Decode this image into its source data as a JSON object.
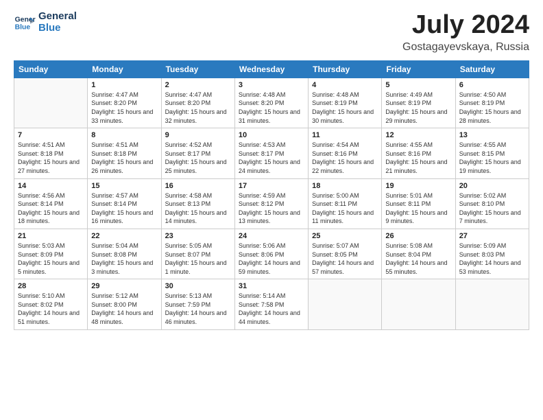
{
  "logo": {
    "line1": "General",
    "line2": "Blue"
  },
  "title": "July 2024",
  "location": "Gostagayevskaya, Russia",
  "days_of_week": [
    "Sunday",
    "Monday",
    "Tuesday",
    "Wednesday",
    "Thursday",
    "Friday",
    "Saturday"
  ],
  "weeks": [
    [
      {
        "day": "",
        "sunrise": "",
        "sunset": "",
        "daylight": ""
      },
      {
        "day": "1",
        "sunrise": "Sunrise: 4:47 AM",
        "sunset": "Sunset: 8:20 PM",
        "daylight": "Daylight: 15 hours and 33 minutes."
      },
      {
        "day": "2",
        "sunrise": "Sunrise: 4:47 AM",
        "sunset": "Sunset: 8:20 PM",
        "daylight": "Daylight: 15 hours and 32 minutes."
      },
      {
        "day": "3",
        "sunrise": "Sunrise: 4:48 AM",
        "sunset": "Sunset: 8:20 PM",
        "daylight": "Daylight: 15 hours and 31 minutes."
      },
      {
        "day": "4",
        "sunrise": "Sunrise: 4:48 AM",
        "sunset": "Sunset: 8:19 PM",
        "daylight": "Daylight: 15 hours and 30 minutes."
      },
      {
        "day": "5",
        "sunrise": "Sunrise: 4:49 AM",
        "sunset": "Sunset: 8:19 PM",
        "daylight": "Daylight: 15 hours and 29 minutes."
      },
      {
        "day": "6",
        "sunrise": "Sunrise: 4:50 AM",
        "sunset": "Sunset: 8:19 PM",
        "daylight": "Daylight: 15 hours and 28 minutes."
      }
    ],
    [
      {
        "day": "7",
        "sunrise": "Sunrise: 4:51 AM",
        "sunset": "Sunset: 8:18 PM",
        "daylight": "Daylight: 15 hours and 27 minutes."
      },
      {
        "day": "8",
        "sunrise": "Sunrise: 4:51 AM",
        "sunset": "Sunset: 8:18 PM",
        "daylight": "Daylight: 15 hours and 26 minutes."
      },
      {
        "day": "9",
        "sunrise": "Sunrise: 4:52 AM",
        "sunset": "Sunset: 8:17 PM",
        "daylight": "Daylight: 15 hours and 25 minutes."
      },
      {
        "day": "10",
        "sunrise": "Sunrise: 4:53 AM",
        "sunset": "Sunset: 8:17 PM",
        "daylight": "Daylight: 15 hours and 24 minutes."
      },
      {
        "day": "11",
        "sunrise": "Sunrise: 4:54 AM",
        "sunset": "Sunset: 8:16 PM",
        "daylight": "Daylight: 15 hours and 22 minutes."
      },
      {
        "day": "12",
        "sunrise": "Sunrise: 4:55 AM",
        "sunset": "Sunset: 8:16 PM",
        "daylight": "Daylight: 15 hours and 21 minutes."
      },
      {
        "day": "13",
        "sunrise": "Sunrise: 4:55 AM",
        "sunset": "Sunset: 8:15 PM",
        "daylight": "Daylight: 15 hours and 19 minutes."
      }
    ],
    [
      {
        "day": "14",
        "sunrise": "Sunrise: 4:56 AM",
        "sunset": "Sunset: 8:14 PM",
        "daylight": "Daylight: 15 hours and 18 minutes."
      },
      {
        "day": "15",
        "sunrise": "Sunrise: 4:57 AM",
        "sunset": "Sunset: 8:14 PM",
        "daylight": "Daylight: 15 hours and 16 minutes."
      },
      {
        "day": "16",
        "sunrise": "Sunrise: 4:58 AM",
        "sunset": "Sunset: 8:13 PM",
        "daylight": "Daylight: 15 hours and 14 minutes."
      },
      {
        "day": "17",
        "sunrise": "Sunrise: 4:59 AM",
        "sunset": "Sunset: 8:12 PM",
        "daylight": "Daylight: 15 hours and 13 minutes."
      },
      {
        "day": "18",
        "sunrise": "Sunrise: 5:00 AM",
        "sunset": "Sunset: 8:11 PM",
        "daylight": "Daylight: 15 hours and 11 minutes."
      },
      {
        "day": "19",
        "sunrise": "Sunrise: 5:01 AM",
        "sunset": "Sunset: 8:11 PM",
        "daylight": "Daylight: 15 hours and 9 minutes."
      },
      {
        "day": "20",
        "sunrise": "Sunrise: 5:02 AM",
        "sunset": "Sunset: 8:10 PM",
        "daylight": "Daylight: 15 hours and 7 minutes."
      }
    ],
    [
      {
        "day": "21",
        "sunrise": "Sunrise: 5:03 AM",
        "sunset": "Sunset: 8:09 PM",
        "daylight": "Daylight: 15 hours and 5 minutes."
      },
      {
        "day": "22",
        "sunrise": "Sunrise: 5:04 AM",
        "sunset": "Sunset: 8:08 PM",
        "daylight": "Daylight: 15 hours and 3 minutes."
      },
      {
        "day": "23",
        "sunrise": "Sunrise: 5:05 AM",
        "sunset": "Sunset: 8:07 PM",
        "daylight": "Daylight: 15 hours and 1 minute."
      },
      {
        "day": "24",
        "sunrise": "Sunrise: 5:06 AM",
        "sunset": "Sunset: 8:06 PM",
        "daylight": "Daylight: 14 hours and 59 minutes."
      },
      {
        "day": "25",
        "sunrise": "Sunrise: 5:07 AM",
        "sunset": "Sunset: 8:05 PM",
        "daylight": "Daylight: 14 hours and 57 minutes."
      },
      {
        "day": "26",
        "sunrise": "Sunrise: 5:08 AM",
        "sunset": "Sunset: 8:04 PM",
        "daylight": "Daylight: 14 hours and 55 minutes."
      },
      {
        "day": "27",
        "sunrise": "Sunrise: 5:09 AM",
        "sunset": "Sunset: 8:03 PM",
        "daylight": "Daylight: 14 hours and 53 minutes."
      }
    ],
    [
      {
        "day": "28",
        "sunrise": "Sunrise: 5:10 AM",
        "sunset": "Sunset: 8:02 PM",
        "daylight": "Daylight: 14 hours and 51 minutes."
      },
      {
        "day": "29",
        "sunrise": "Sunrise: 5:12 AM",
        "sunset": "Sunset: 8:00 PM",
        "daylight": "Daylight: 14 hours and 48 minutes."
      },
      {
        "day": "30",
        "sunrise": "Sunrise: 5:13 AM",
        "sunset": "Sunset: 7:59 PM",
        "daylight": "Daylight: 14 hours and 46 minutes."
      },
      {
        "day": "31",
        "sunrise": "Sunrise: 5:14 AM",
        "sunset": "Sunset: 7:58 PM",
        "daylight": "Daylight: 14 hours and 44 minutes."
      },
      {
        "day": "",
        "sunrise": "",
        "sunset": "",
        "daylight": ""
      },
      {
        "day": "",
        "sunrise": "",
        "sunset": "",
        "daylight": ""
      },
      {
        "day": "",
        "sunrise": "",
        "sunset": "",
        "daylight": ""
      }
    ]
  ]
}
